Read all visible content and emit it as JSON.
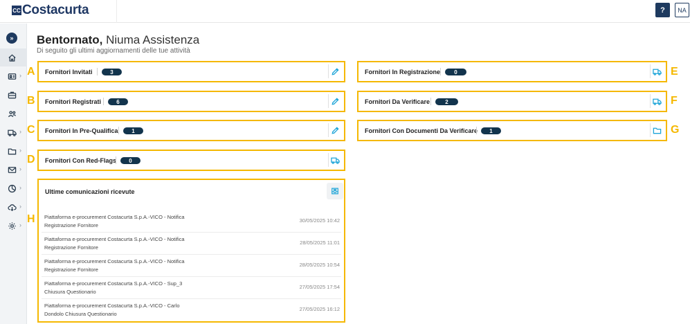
{
  "header": {
    "logo_mark": "CC",
    "logo_text": "Costacurta",
    "help_label": "?",
    "user_initials": "NA"
  },
  "sidebar": {
    "collapse_icon": "chevron-double-right-icon",
    "items": [
      {
        "icon": "home-icon",
        "active": true
      },
      {
        "icon": "id-card-icon"
      },
      {
        "icon": "briefcase-icon"
      },
      {
        "icon": "users-icon"
      },
      {
        "icon": "truck-icon"
      },
      {
        "icon": "folder-icon"
      },
      {
        "icon": "mail-icon"
      },
      {
        "icon": "pie-chart-icon"
      },
      {
        "icon": "cloud-download-icon"
      },
      {
        "icon": "gear-icon"
      }
    ]
  },
  "welcome": {
    "greeting": "Bentornato,",
    "name": "Niuma Assistenza",
    "subtitle": "Di seguito gli ultimi aggiornamenti delle tue attività"
  },
  "cards": {
    "invitati": {
      "title": "Fornitori Invitati",
      "count": "3",
      "letter": "A"
    },
    "registrati": {
      "title": "Fornitori Registrati",
      "count": "6",
      "letter": "B"
    },
    "prequalifica": {
      "title": "Fornitori In Pre-Qualifica",
      "count": "1",
      "letter": "C"
    },
    "redflags": {
      "title": "Fornitori Con Red-Flags",
      "count": "0",
      "letter": "D"
    },
    "in_registrazione": {
      "title": "Fornitori In Registrazione",
      "count": "0",
      "letter": "E"
    },
    "da_verificare": {
      "title": "Fornitori Da Verificare",
      "count": "2",
      "letter": "F"
    },
    "documenti": {
      "title": "Fornitori Con Documenti Da Verificare",
      "count": "1",
      "letter": "G"
    }
  },
  "messages": {
    "title": "Ultime comunicazioni ricevute",
    "letter": "H",
    "items": [
      {
        "line1": "Piattaforma e-procurement Costacurta S.p.A.-VICO - Notifica",
        "line2": "Registrazione Fornitore",
        "date": "30/05/2025 10:42"
      },
      {
        "line1": "Piattaforma e-procurement Costacurta S.p.A.-VICO - Notifica",
        "line2": "Registrazione Fornitore",
        "date": "28/05/2025 11:01"
      },
      {
        "line1": "Piattaforma e-procurement Costacurta S.p.A.-VICO - Notifica",
        "line2": "Registrazione Fornitore",
        "date": "28/05/2025 10:54"
      },
      {
        "line1": "Piattaforma e-procurement Costacurta S.p.A.-VICO - Sup_3",
        "line2": "Chiusura Questionario",
        "date": "27/05/2025 17:54"
      },
      {
        "line1": "Piattaforma e-procurement Costacurta S.p.A.-VICO - Carlo",
        "line2": "Dondolo Chiusura Questionario",
        "date": "27/05/2025 16:12"
      }
    ]
  },
  "colors": {
    "highlight": "#f5b800",
    "badge": "#12344d",
    "accent": "#1ea5d8"
  }
}
